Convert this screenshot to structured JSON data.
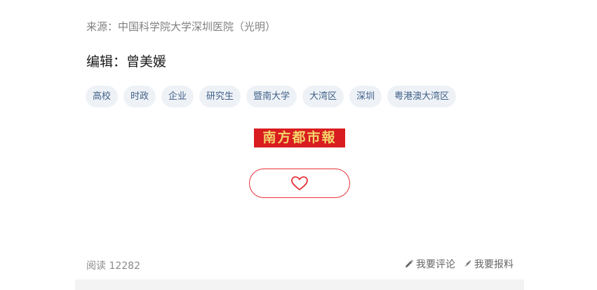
{
  "article": {
    "source": "来源：中国科学院大学深圳医院（光明）",
    "editor": "编辑：曾美媛"
  },
  "tags": [
    "高校",
    "时政",
    "企业",
    "研究生",
    "暨南大学",
    "大湾区",
    "深圳",
    "粤港澳大湾区"
  ],
  "brand": {
    "logo_text": "南方都市報",
    "logo_bg": "#d91c20",
    "logo_fg": "#f3d36a"
  },
  "like": {
    "icon": "heart-outline-icon",
    "color": "#e5333a"
  },
  "footer": {
    "read_count": "阅读 12282",
    "comment_label": "我要评论",
    "comment_icon": "pencil-icon",
    "report_label": "我要报料",
    "report_icon": "quill-icon"
  },
  "colors": {
    "tag_bg": "#eef2f7",
    "tag_text": "#3f5f86",
    "muted_text": "#808080"
  }
}
